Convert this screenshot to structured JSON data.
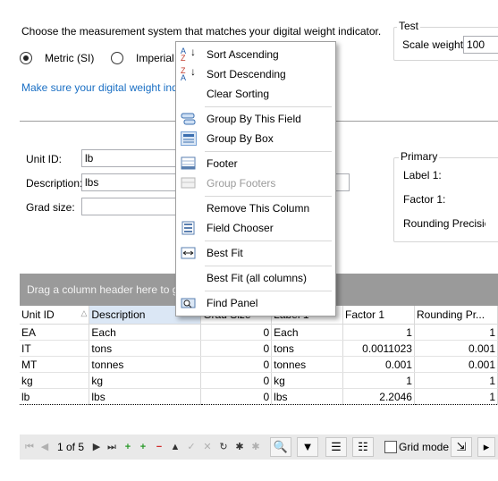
{
  "instruction": "Choose the measurement system that matches your digital weight indicator.",
  "radios": {
    "metric": "Metric (SI)",
    "imperial": "Imperial ("
  },
  "link": "Make sure your digital weight indicat",
  "test": {
    "title": "Test",
    "scale_label": "Scale weight:",
    "scale_value": "100"
  },
  "unit_form": {
    "unit_id_label": "Unit ID:",
    "unit_id_value": "lb",
    "description_label": "Description:",
    "description_value": "lbs",
    "grad_label": "Grad size:",
    "grad_value": ""
  },
  "primary": {
    "title": "Primary",
    "label1": "Label 1:",
    "factor1": "Factor 1:",
    "rounding": "Rounding Precisio"
  },
  "grid": {
    "group_panel": "Drag a column header here to grou",
    "columns": [
      "Unit ID",
      "Description",
      "Grad Size",
      "Label 1",
      "Factor 1",
      "Rounding Pr..."
    ],
    "rows": [
      {
        "unit": "EA",
        "desc": "Each",
        "grad": "0",
        "label": "Each",
        "factor": "1",
        "round": "1"
      },
      {
        "unit": "IT",
        "desc": "tons",
        "grad": "0",
        "label": "tons",
        "factor": "0.0011023",
        "round": "0.001"
      },
      {
        "unit": "MT",
        "desc": "tonnes",
        "grad": "0",
        "label": "tonnes",
        "factor": "0.001",
        "round": "0.001"
      },
      {
        "unit": "kg",
        "desc": "kg",
        "grad": "0",
        "label": "kg",
        "factor": "1",
        "round": "1"
      },
      {
        "unit": "lb",
        "desc": "lbs",
        "grad": "0",
        "label": "lbs",
        "factor": "2.2046",
        "round": "1"
      }
    ]
  },
  "navigator": {
    "position": "1 of 5",
    "grid_mode": "Grid mode"
  },
  "context_menu": {
    "items": [
      {
        "label": "Sort Ascending",
        "icon": "sort-ascending-icon",
        "enabled": true
      },
      {
        "label": "Sort Descending",
        "icon": "sort-descending-icon",
        "enabled": true
      },
      {
        "label": "Clear Sorting",
        "icon": "",
        "enabled": true
      },
      {
        "label": "Group By This Field",
        "icon": "group-by-field-icon",
        "enabled": true
      },
      {
        "label": "Group By Box",
        "icon": "group-by-box-icon",
        "enabled": true
      },
      {
        "label": "Footer",
        "icon": "footer-icon",
        "enabled": true
      },
      {
        "label": "Group Footers",
        "icon": "group-footers-icon",
        "enabled": false
      },
      {
        "label": "Remove This Column",
        "icon": "",
        "enabled": true
      },
      {
        "label": "Field Chooser",
        "icon": "field-chooser-icon",
        "enabled": true
      },
      {
        "label": "Best Fit",
        "icon": "best-fit-icon",
        "enabled": true
      },
      {
        "label": "Best Fit (all columns)",
        "icon": "",
        "enabled": true
      },
      {
        "label": "Find Panel",
        "icon": "find-panel-icon",
        "enabled": true
      }
    ]
  },
  "colors": {
    "accent_link": "#1a6fc4",
    "group_panel_bg": "#9a9a9a",
    "selected_header": "#dbe7f5"
  }
}
